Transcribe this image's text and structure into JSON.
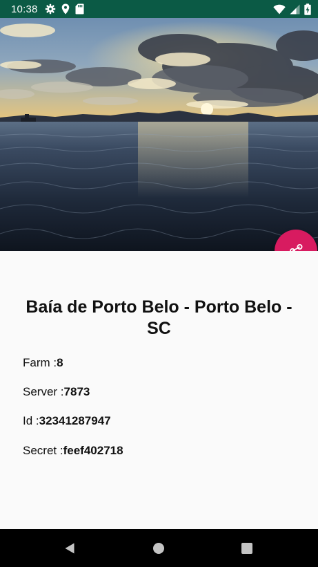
{
  "status_bar": {
    "time": "10:38",
    "left_icons": [
      "gear-icon",
      "location-icon",
      "sd-card-icon"
    ],
    "right_icons": [
      "wifi-icon",
      "cell-signal-icon",
      "battery-charging-icon"
    ],
    "background": "#0b5a45"
  },
  "photo": {
    "title": "Baía de Porto Belo - Porto Belo - SC",
    "fields": [
      {
        "label": "Farm :",
        "value": "8"
      },
      {
        "label": "Server :",
        "value": "7873"
      },
      {
        "label": "Id :",
        "value": "32341287947"
      },
      {
        "label": "Secret :",
        "value": "feef402718"
      }
    ]
  },
  "fab": {
    "icon": "share-icon",
    "color": "#d81b60"
  },
  "navigation": {
    "buttons": [
      "back-icon",
      "home-icon",
      "recents-icon"
    ]
  }
}
